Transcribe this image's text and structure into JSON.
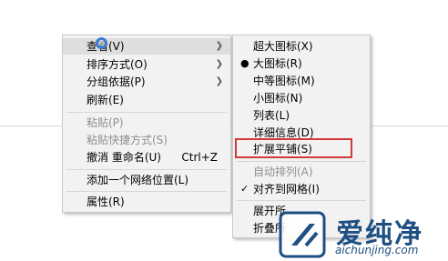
{
  "context_menu": {
    "items": [
      {
        "label": "查看(V)",
        "has_submenu": true
      },
      {
        "label": "排序方式(O)",
        "has_submenu": true
      },
      {
        "label": "分组依据(P)",
        "has_submenu": true
      },
      {
        "label": "刷新(E)"
      },
      {
        "label": "粘贴(P)",
        "disabled": true
      },
      {
        "label": "粘贴快捷方式(S)",
        "disabled": true
      },
      {
        "label": "撤消 重命名(U)",
        "shortcut": "Ctrl+Z"
      },
      {
        "label": "添加一个网络位置(L)"
      },
      {
        "label": "属性(R)"
      }
    ]
  },
  "view_submenu": {
    "items": [
      {
        "label": "超大图标(X)"
      },
      {
        "label": "大图标(R)",
        "selected": true
      },
      {
        "label": "中等图标(M)"
      },
      {
        "label": "小图标(N)"
      },
      {
        "label": "列表(L)"
      },
      {
        "label": "详细信息(D)"
      },
      {
        "label": "扩展平铺(S)",
        "highlighted": true
      },
      {
        "label": "自动排列(A)",
        "disabled": true
      },
      {
        "label": "对齐到网格(I)",
        "checked": true
      },
      {
        "label": "展开所"
      },
      {
        "label": "折叠所"
      }
    ],
    "bullet": "●",
    "check": "✓"
  },
  "watermark": {
    "text": "爱纯净",
    "url": "aichunjing.com"
  },
  "colors": {
    "highlight_border": "#d23a3a",
    "watermark": "#1e4f82"
  }
}
